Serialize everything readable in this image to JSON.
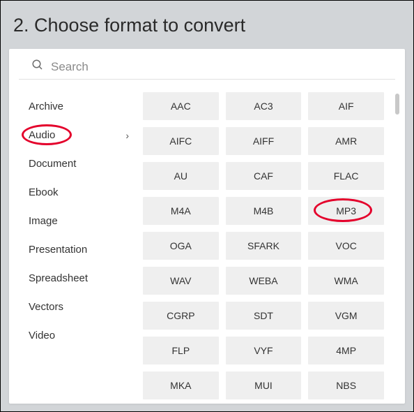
{
  "header": {
    "title": "2. Choose format to convert"
  },
  "search": {
    "placeholder": "Search",
    "value": ""
  },
  "sidebar": {
    "items": [
      {
        "label": "Archive",
        "selected": false
      },
      {
        "label": "Audio",
        "selected": true
      },
      {
        "label": "Document",
        "selected": false
      },
      {
        "label": "Ebook",
        "selected": false
      },
      {
        "label": "Image",
        "selected": false
      },
      {
        "label": "Presentation",
        "selected": false
      },
      {
        "label": "Spreadsheet",
        "selected": false
      },
      {
        "label": "Vectors",
        "selected": false
      },
      {
        "label": "Video",
        "selected": false
      }
    ]
  },
  "formats": [
    "AAC",
    "AC3",
    "AIF",
    "AIFC",
    "AIFF",
    "AMR",
    "AU",
    "CAF",
    "FLAC",
    "M4A",
    "M4B",
    "MP3",
    "OGA",
    "SFARK",
    "VOC",
    "WAV",
    "WEBA",
    "WMA",
    "CGRP",
    "SDT",
    "VGM",
    "FLP",
    "VYF",
    "4MP",
    "MKA",
    "MUI",
    "NBS"
  ],
  "annotations": {
    "circled_category": "Audio",
    "circled_format": "MP3"
  }
}
